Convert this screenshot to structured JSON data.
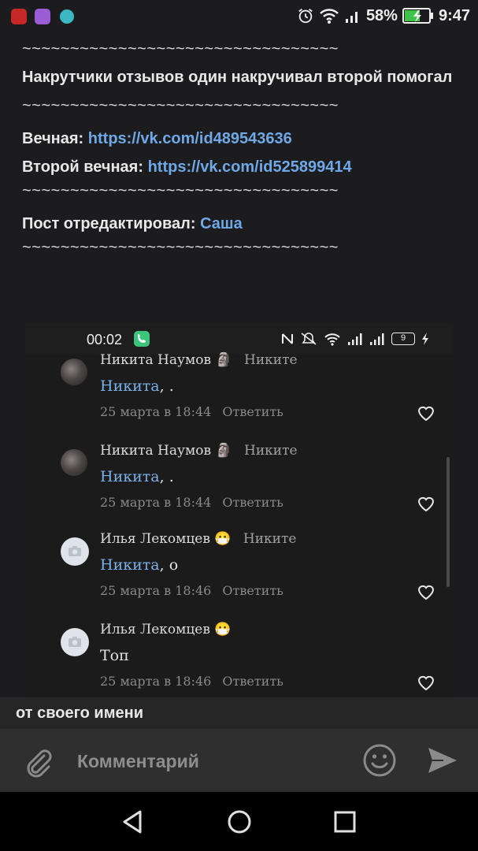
{
  "status_bar": {
    "battery_pct": "58%",
    "time": "9:47",
    "app_icon_colors": [
      "#c62828",
      "#9c5cd6",
      "#3cb8c4"
    ]
  },
  "post": {
    "sep1": "~~~~~~~~~~~~~~~~~~~~~~~~~~~~~~~~~",
    "line1": "Накрутчики отзывов один накручивал  второй помогал",
    "sep2": "~~~~~~~~~~~~~~~~~~~~~~~~~~~~~~~~~",
    "label1": "Вечная: ",
    "link1": "https://vk.com/id489543636",
    "label2": "Второй вечная: ",
    "link2": "https://vk.com/id525899414",
    "sep3": "~~~~~~~~~~~~~~~~~~~~~~~~~~~~~~~~~",
    "edited_label": "Пост отредактировал: ",
    "editor": "Саша",
    "sep4": "~~~~~~~~~~~~~~~~~~~~~~~~~~~~~~~~~"
  },
  "screenshot": {
    "status_time": "00:02",
    "battery": "9",
    "comments": [
      {
        "author": "Никита Наумов",
        "author_emoji": "🗿",
        "reply_to": "Никите",
        "mention": "Никита",
        "text": ", .",
        "date": "25 марта в 18:44",
        "reply_label": "Ответить",
        "avatar": "photo"
      },
      {
        "author": "Никита Наумов",
        "author_emoji": "🗿",
        "reply_to": "Никите",
        "mention": "Никита",
        "text": ", .",
        "date": "25 марта в 18:44",
        "reply_label": "Ответить",
        "avatar": "photo"
      },
      {
        "author": "Илья Лекомцев",
        "author_emoji": "😷",
        "reply_to": "Никите",
        "mention": "Никита",
        "text": ", о",
        "date": "25 марта в 18:46",
        "reply_label": "Ответить",
        "avatar": "camera"
      },
      {
        "author": "Илья Лекомцев",
        "author_emoji": "😷",
        "reply_to": "",
        "mention": "",
        "text": "Топ",
        "date": "25 марта в 18:46",
        "reply_label": "Ответить",
        "avatar": "camera"
      }
    ]
  },
  "caption": "от своего имени",
  "composer": {
    "placeholder": "Комментарий"
  },
  "colors": {
    "link": "#6ea8e6",
    "background": "#1c1c1e"
  }
}
